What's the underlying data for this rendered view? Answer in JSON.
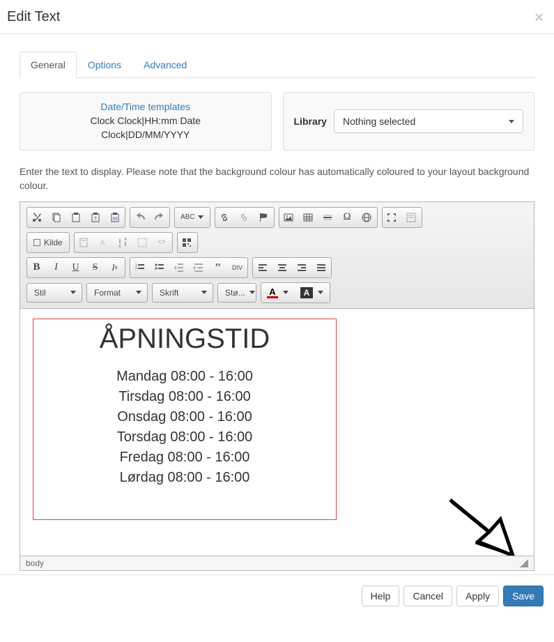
{
  "header": {
    "title": "Edit Text"
  },
  "tabs": [
    {
      "label": "General",
      "active": true
    },
    {
      "label": "Options",
      "active": false
    },
    {
      "label": "Advanced",
      "active": false
    }
  ],
  "datetime_panel": {
    "link": "Date/Time templates",
    "line1": "Clock Clock|HH:mm Date",
    "line2": "Clock|DD/MM/YYYY"
  },
  "library": {
    "label": "Library",
    "selected": "Nothing selected"
  },
  "instruction": "Enter the text to display. Please note that the background colour has automatically coloured to your layout background colour.",
  "toolbar": {
    "source_label": "Kilde",
    "combos": {
      "style": "Stil",
      "format": "Format",
      "font": "Skrift",
      "size": "Stø..."
    }
  },
  "content": {
    "title": "ÅPNINGSTID",
    "lines": [
      "Mandag 08:00 - 16:00",
      "Tirsdag 08:00 - 16:00",
      "Onsdag 08:00 - 16:00",
      "Torsdag 08:00 - 16:00",
      "Fredag 08:00 - 16:00",
      "Lørdag 08:00 - 16:00"
    ]
  },
  "status": {
    "path": "body"
  },
  "buttons": {
    "help": "Help",
    "cancel": "Cancel",
    "apply": "Apply",
    "save": "Save"
  }
}
